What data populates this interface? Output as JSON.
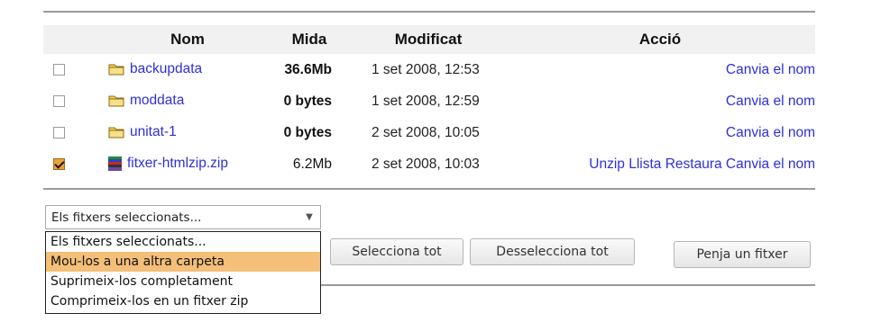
{
  "table": {
    "headers": {
      "name": "Nom",
      "size": "Mida",
      "modified": "Modificat",
      "action": "Acció"
    },
    "rows": [
      {
        "checked": false,
        "icon": "folder-icon",
        "name": "backupdata",
        "size": "36.6Mb",
        "size_bold": true,
        "modified": "1 set 2008, 12:53",
        "actions": [
          "Canvia el nom"
        ]
      },
      {
        "checked": false,
        "icon": "folder-icon",
        "name": "moddata",
        "size": "0 bytes",
        "size_bold": true,
        "modified": "1 set 2008, 12:59",
        "actions": [
          "Canvia el nom"
        ]
      },
      {
        "checked": false,
        "icon": "folder-icon",
        "name": "unitat-1",
        "size": "0 bytes",
        "size_bold": true,
        "modified": "2 set 2008, 10:05",
        "actions": [
          "Canvia el nom"
        ]
      },
      {
        "checked": true,
        "icon": "zip-icon",
        "name": "fitxer-htmlzip.zip",
        "size": "6.2Mb",
        "size_bold": false,
        "modified": "2 set 2008, 10:03",
        "actions": [
          "Unzip",
          "Llista",
          "Restaura",
          "Canvia el nom"
        ]
      }
    ]
  },
  "selection_menu": {
    "value": "Els fitxers seleccionats...",
    "options": [
      "Els fitxers seleccionats...",
      "Mou-los a una altra carpeta",
      "Suprimeix-los completament",
      "Comprimeix-los en un fitxer zip"
    ],
    "highlighted_option": 1
  },
  "buttons": {
    "select_all": "Selecciona tot",
    "deselect_all": "Desselecciona tot",
    "upload": "Penja un fitxer"
  },
  "colors": {
    "link": "#2f2fd8",
    "header_bg": "#f1f1f1",
    "highlight": "#f4bf78",
    "checkbox_checked": "#e9a33b"
  }
}
